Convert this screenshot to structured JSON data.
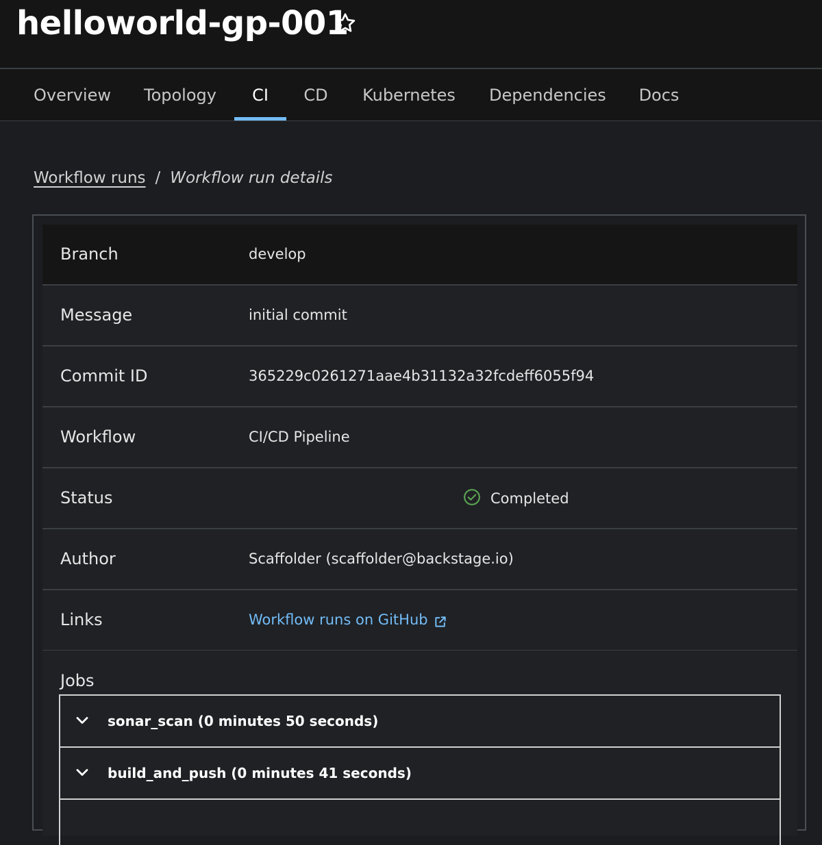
{
  "header": {
    "title": "helloworld-gp-001",
    "star_icon": "star-outline-icon"
  },
  "tabs": [
    {
      "label": "Overview",
      "active": false
    },
    {
      "label": "Topology",
      "active": false
    },
    {
      "label": "CI",
      "active": true
    },
    {
      "label": "CD",
      "active": false
    },
    {
      "label": "Kubernetes",
      "active": false
    },
    {
      "label": "Dependencies",
      "active": false
    },
    {
      "label": "Docs",
      "active": false
    }
  ],
  "breadcrumb": {
    "link": "Workflow runs",
    "separator": "/",
    "current": "Workflow run details"
  },
  "details": {
    "branch": {
      "label": "Branch",
      "value": "develop"
    },
    "message": {
      "label": "Message",
      "value": "initial commit"
    },
    "commit": {
      "label": "Commit ID",
      "value": "365229c0261271aae4b31132a32fcdeff6055f94"
    },
    "workflow": {
      "label": "Workflow",
      "value": "CI/CD Pipeline"
    },
    "status": {
      "label": "Status",
      "value": "Completed",
      "color": "#5ba352"
    },
    "author": {
      "label": "Author",
      "value": "Scaffolder (scaffolder@backstage.io)"
    },
    "links": {
      "label": "Links",
      "value": "Workflow runs on GitHub",
      "color": "#73bcf7"
    }
  },
  "jobs": {
    "label": "Jobs",
    "items": [
      {
        "title": "sonar_scan (0 minutes 50 seconds)"
      },
      {
        "title": "build_and_push (0 minutes 41 seconds)"
      }
    ]
  },
  "colors": {
    "accent": "#73bcf7",
    "success": "#5ba352",
    "background": "#1b1d21",
    "header": "#151515"
  }
}
